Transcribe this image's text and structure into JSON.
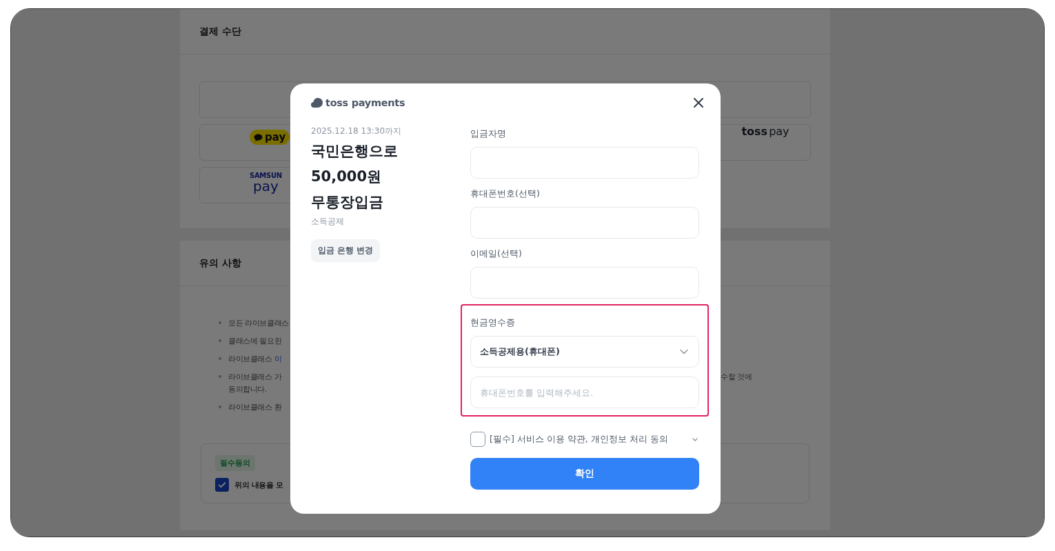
{
  "page": {
    "payment": {
      "title": "결제 수단",
      "rows": [
        [
          {
            "kind": "blank"
          }
        ],
        [
          {
            "kind": "kakaopay",
            "label": "pay"
          },
          {
            "kind": "tosspay",
            "label": "toss",
            "suffix": "pay"
          }
        ],
        [
          {
            "kind": "samsungpay",
            "label": "SAMSUN",
            "suffix": "pay"
          }
        ]
      ]
    },
    "notices": {
      "title": "유의 사항",
      "items": [
        {
          "text": "모든 라이브클래스"
        },
        {
          "text": "클래스에 필요한"
        },
        {
          "text": "라이브클래스",
          "link": "이"
        },
        {
          "text": "라이브클래스 가",
          "tail": "수할 것에",
          "continuation": "동의합니다."
        },
        {
          "text": "라이브클래스 환"
        }
      ]
    },
    "agreement": {
      "badge": "필수동의",
      "checked": true,
      "label": "위의 내용을 모"
    }
  },
  "modal": {
    "logo": "toss payments",
    "deadline": "2025.12.18 13:30까지",
    "title_lines": [
      "국민은행으로",
      "50,000원",
      "무통장입금"
    ],
    "subtitle": "소득공제",
    "change_bank_button": "입금 은행 변경",
    "fields": [
      {
        "label": "입금자명"
      },
      {
        "label": "휴대폰번호(선택)"
      },
      {
        "label": "이메일(선택)"
      }
    ],
    "cash_receipt": {
      "label": "현금영수증",
      "highlighted": true,
      "select_value": "소득공제용(휴대폰)",
      "input_placeholder": "휴대폰번호를 입력해주세요."
    },
    "consent": {
      "checked": false,
      "label": "[필수] 서비스 이용 약관, 개인정보 처리 동의"
    },
    "confirm_button": "확인"
  }
}
